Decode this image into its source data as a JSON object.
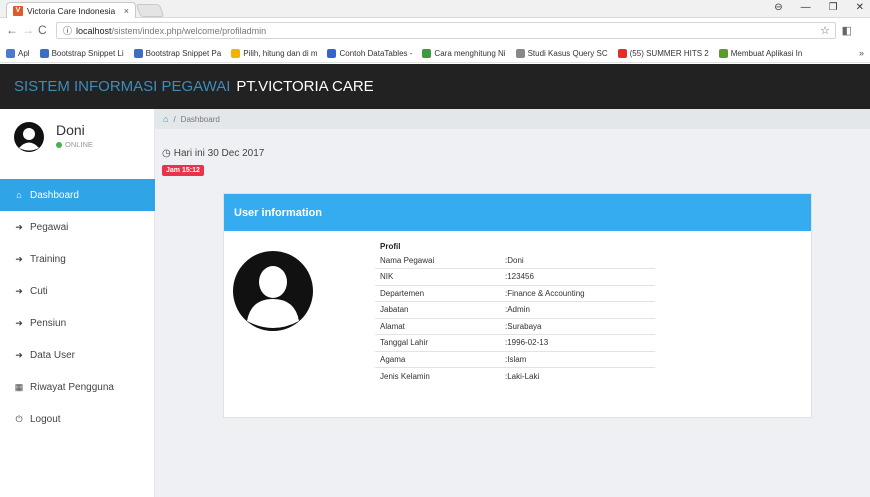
{
  "browser": {
    "tab_title": "Victoria Care Indonesia",
    "tab_close": "×",
    "url_host": "localhost",
    "url_path": "/sistem/index.php/welcome/profiladmin",
    "bookmarks": [
      {
        "label": "Apl",
        "color": "#4a7bd0"
      },
      {
        "label": "Bootstrap Snippet Li",
        "color": "#3a6fc4"
      },
      {
        "label": "Bootstrap Snippet Pa",
        "color": "#3a6fc4"
      },
      {
        "label": "Pilih, hitung dan di m",
        "color": "#f0b400"
      },
      {
        "label": "Contoh DataTables -",
        "color": "#3366cc"
      },
      {
        "label": "Cara menghitung Ni",
        "color": "#3d9a3d"
      },
      {
        "label": "Studi Kasus Query SC",
        "color": "#888888"
      },
      {
        "label": "(55) SUMMER HITS 2",
        "color": "#e52d27"
      },
      {
        "label": "Membuat Aplikasi In",
        "color": "#5c9a2b"
      }
    ],
    "bookmarks_more": "»"
  },
  "header": {
    "brand_part1": "SISTEM INFORMASI PEGAWAI",
    "brand_part2": "PT.VICTORIA CARE"
  },
  "sidebar": {
    "user_name": "Doni",
    "user_status": "ONLINE",
    "items": [
      {
        "label": "Dashboard",
        "icon": "home-icon",
        "glyph": "⌂",
        "active": true
      },
      {
        "label": "Pegawai",
        "icon": "circle-arrow-icon",
        "glyph": "➜",
        "active": false
      },
      {
        "label": "Training",
        "icon": "circle-arrow-icon",
        "glyph": "➜",
        "active": false
      },
      {
        "label": "Cuti",
        "icon": "circle-arrow-icon",
        "glyph": "➜",
        "active": false
      },
      {
        "label": "Pensiun",
        "icon": "circle-arrow-icon",
        "glyph": "➜",
        "active": false
      },
      {
        "label": "Data User",
        "icon": "circle-arrow-icon",
        "glyph": "➜",
        "active": false
      },
      {
        "label": "Riwayat Pengguna",
        "icon": "calendar-icon",
        "glyph": "▦",
        "active": false
      },
      {
        "label": "Logout",
        "icon": "power-icon",
        "glyph": "⏻",
        "active": false
      }
    ]
  },
  "content": {
    "breadcrumb": "Dashboard",
    "date_text": "Hari ini 30 Dec 2017",
    "clock_text": "Jam 15:12",
    "panel_title": "User information",
    "profil_title": "Profil",
    "rows": [
      {
        "key": "Nama Pegawai",
        "value": ":Doni"
      },
      {
        "key": "NIK",
        "value": ":123456"
      },
      {
        "key": "Departemen",
        "value": ":Finance & Accounting"
      },
      {
        "key": "Jabatan",
        "value": ":Admin"
      },
      {
        "key": "Alamat",
        "value": ":Surabaya"
      },
      {
        "key": "Tanggal Lahir",
        "value": ":1996-02-13"
      },
      {
        "key": "Agama",
        "value": ":Islam"
      },
      {
        "key": "Jenis Kelamin",
        "value": ":Laki-Laki"
      }
    ]
  },
  "colors": {
    "accent": "#2fa4e7",
    "panel_head": "#35acf0",
    "header_bg": "#222222",
    "brand_blue": "#3c8dbc",
    "badge_red": "#e8334a"
  }
}
